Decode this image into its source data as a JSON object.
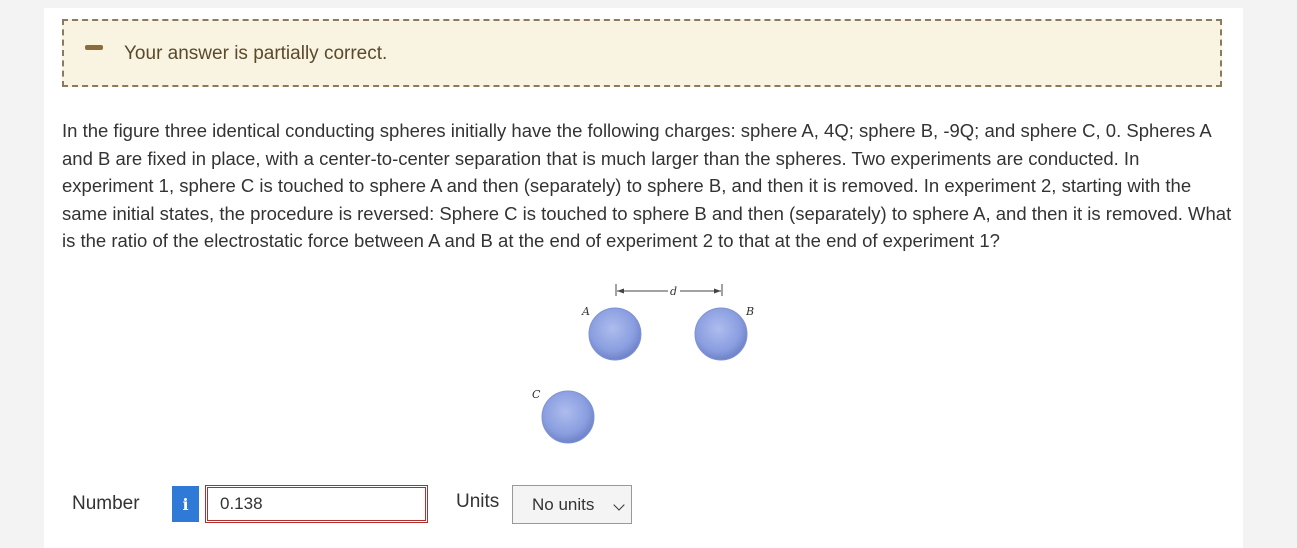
{
  "feedback": {
    "message": "Your answer is partially correct."
  },
  "question": {
    "text": "In the figure three identical conducting spheres initially have the following charges: sphere A, 4Q; sphere B, -9Q; and sphere C, 0. Spheres A and B are fixed in place, with a center-to-center separation that is much larger than the spheres. Two experiments are conducted. In experiment 1, sphere C is touched to sphere A and then (separately) to sphere B, and then it is removed. In experiment 2, starting with the same initial states, the procedure is reversed: Sphere C is touched to sphere B and then (separately) to sphere A, and then it is removed. What is the ratio of the electrostatic force between A and B at the end of experiment 2 to that at the end of experiment 1?"
  },
  "figure": {
    "label_a": "A",
    "label_b": "B",
    "label_c": "C",
    "label_d": "d",
    "sphere_color": "#8a9ee0"
  },
  "answer": {
    "label": "Number",
    "info_icon": "i",
    "value": "0.138",
    "units_label": "Units",
    "units_value": "No units"
  }
}
